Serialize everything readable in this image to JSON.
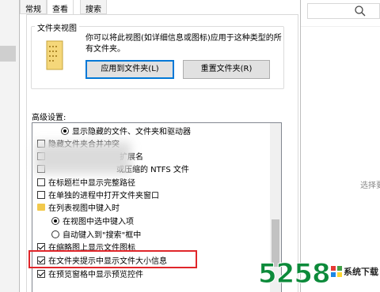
{
  "tabs": [
    "常规",
    "查看",
    "搜索"
  ],
  "folder_views": {
    "title": "文件夹视图",
    "description_line1": "你可以将此视图(如详细信息或图标)应用于这种类型的所",
    "description_line2": "有文件夹。",
    "apply_button": "应用到文件夹(L)",
    "reset_button": "重置文件夹(R)"
  },
  "advanced": {
    "label": "高级设置:",
    "rows": [
      {
        "type": "radio",
        "checked": true,
        "text": "显示隐藏的文件、文件夹和驱动器"
      },
      {
        "type": "checkbox",
        "checked": false,
        "text": "隐藏文件夹合并冲突"
      },
      {
        "type": "checkbox",
        "checked": false,
        "text": "扩展名"
      },
      {
        "type": "checkbox",
        "checked": false,
        "text": "或压缩的 NTFS 文件"
      },
      {
        "type": "checkbox",
        "checked": false,
        "text": "在标题栏中显示完整路径"
      },
      {
        "type": "checkbox",
        "checked": false,
        "text": "在单独的进程中打开文件夹窗口"
      },
      {
        "type": "folder",
        "checked": false,
        "text": "在列表视图中键入时"
      },
      {
        "type": "radio",
        "checked": true,
        "text": "在视图中选中键入项"
      },
      {
        "type": "radio",
        "checked": false,
        "text": "自动键入到\"搜索\"框中"
      },
      {
        "type": "checkbox",
        "checked": true,
        "text": "在缩略图上显示文件图标"
      },
      {
        "type": "checkbox",
        "checked": true,
        "text": "在文件夹提示中显示文件大小信息"
      },
      {
        "type": "checkbox",
        "checked": true,
        "text": "在预览窗格中显示预览控件"
      }
    ]
  },
  "background": {
    "hint_text": "选择要"
  },
  "watermark": {
    "number": "5258",
    "text": "系统下载"
  },
  "colors": {
    "highlight": "#e0262a",
    "watermark_green": "#0c8a3a",
    "accent_blue": "#0078d7"
  }
}
